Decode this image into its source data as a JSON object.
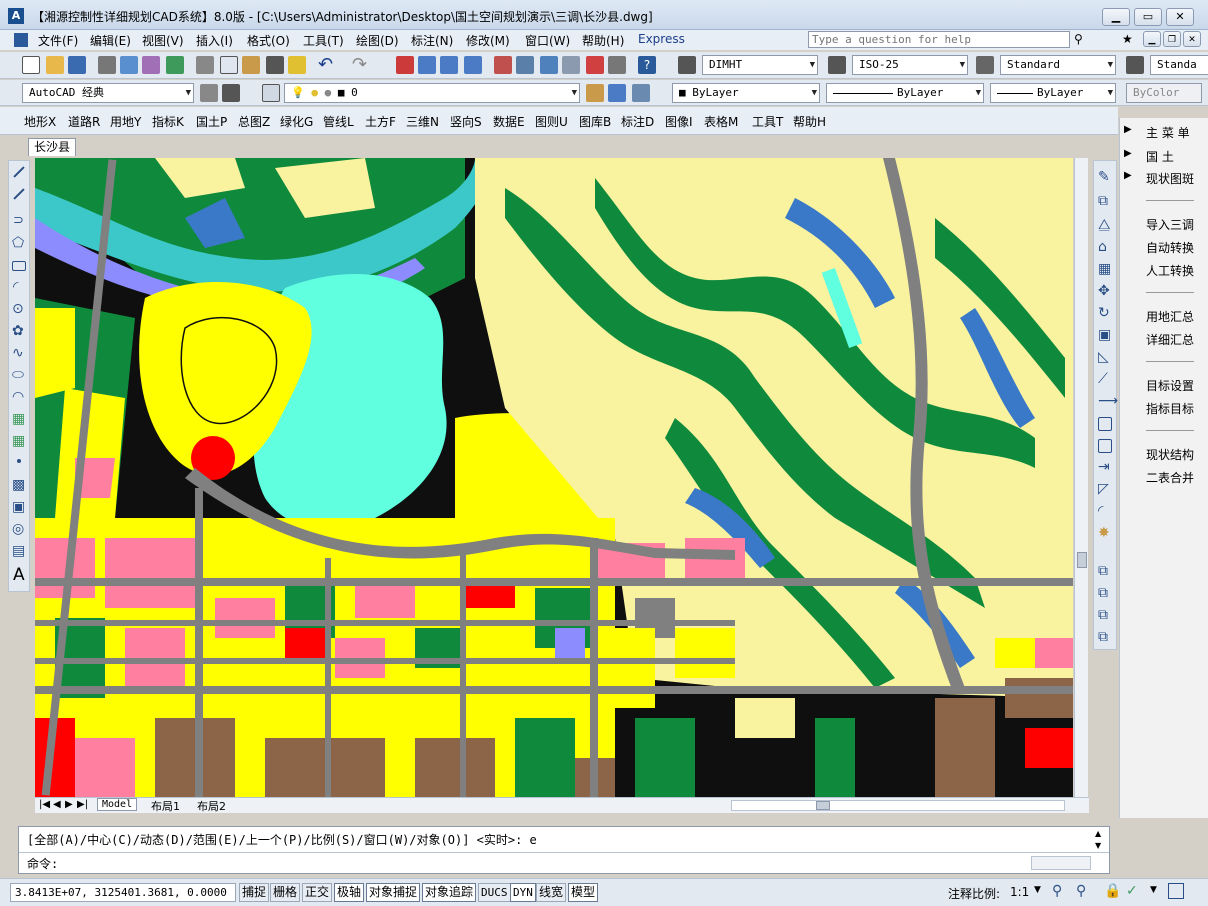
{
  "window": {
    "title": "【湘源控制性详细规划CAD系统】8.0版 - [C:\\Users\\Administrator\\Desktop\\国土空间规划演示\\三调\\长沙县.dwg]",
    "app_icon": "autocad-logo-icon"
  },
  "menubar": {
    "items": [
      "文件(F)",
      "编辑(E)",
      "视图(V)",
      "插入(I)",
      "格式(O)",
      "工具(T)",
      "绘图(D)",
      "标注(N)",
      "修改(M)",
      "窗口(W)",
      "帮助(H)",
      "Express"
    ],
    "help_search_placeholder": "Type a question for help"
  },
  "toolbar2": {
    "dimstyle": "DIMHT",
    "dimstd": "ISO-25",
    "textstyle": "Standard",
    "tablestyle": "Standa"
  },
  "toolbar3": {
    "workspace": "AutoCAD 经典",
    "layer": "0",
    "color": "ByLayer",
    "linetype": "ByLayer",
    "lineweight": "ByLayer",
    "plotstyle": "ByColor"
  },
  "cn_menu": {
    "items": [
      "地形X",
      "道路R",
      "用地Y",
      "指标K",
      "国土P",
      "总图Z",
      "绿化G",
      "管线L",
      "土方F",
      "三维N",
      "竖向S",
      "数据E",
      "图则U",
      "图库B",
      "标注D",
      "图像I",
      "表格M",
      "工具T",
      "帮助H"
    ]
  },
  "document_tab": "长沙县",
  "layout_tabs": [
    "Model",
    "布局1",
    "布局2"
  ],
  "right_panel": {
    "items": [
      "主 菜 单",
      "国    土",
      "现状图斑",
      "导入三调",
      "自动转换",
      "人工转换",
      "用地汇总",
      "详细汇总",
      "目标设置",
      "指标目标",
      "现状结构",
      "二表合并"
    ]
  },
  "command": {
    "history": "[全部(A)/中心(C)/动态(D)/范围(E)/上一个(P)/比例(S)/窗口(W)/对象(O)] <实时>: e",
    "prompt": "命令:"
  },
  "status": {
    "coords": "3.8413E+07, 3125401.3681, 0.0000",
    "toggles": [
      "捕捉",
      "栅格",
      "正交",
      "极轴",
      "对象捕捉",
      "对象追踪",
      "DUCS",
      "DYN",
      "线宽",
      "模型"
    ],
    "annotation_scale_label": "注释比例:",
    "annotation_scale": "1:1"
  },
  "map_colors": {
    "background": "#0f0f0f",
    "forest": "#0f8a3c",
    "farmland": "#f9f3a0",
    "urban": "#ffff00",
    "residential": "#ff7fa0",
    "water": "#5fffe0",
    "river": "#3cc8c8",
    "road": "#808080",
    "commercial": "#ff0000",
    "industrial": "#8c6448",
    "public": "#8c8cff"
  }
}
